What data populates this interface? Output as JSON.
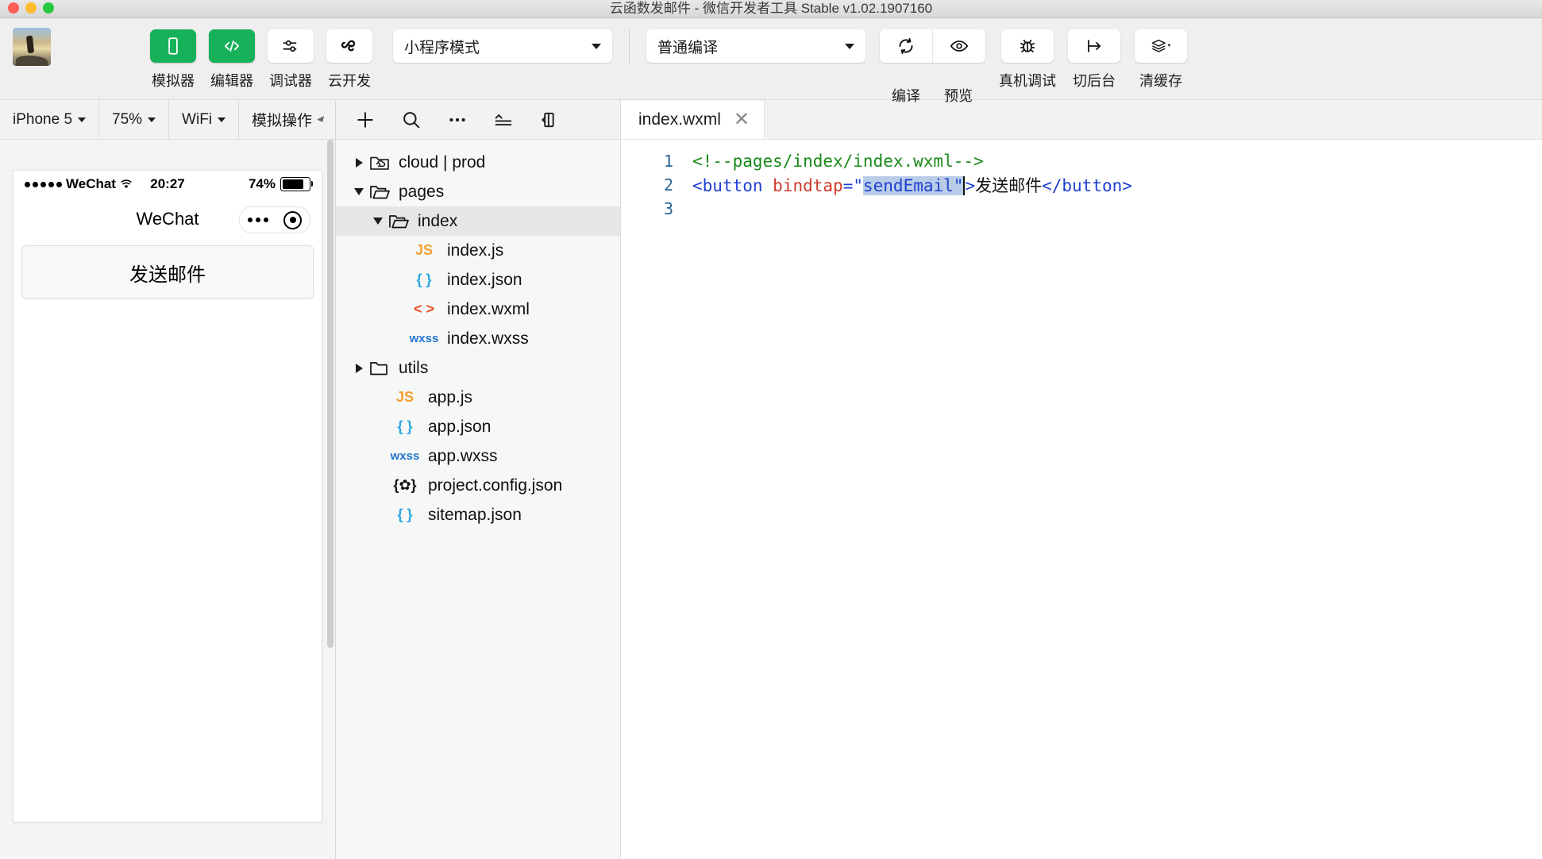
{
  "window": {
    "title": "云函数发邮件 - 微信开发者工具 Stable v1.02.1907160"
  },
  "toolbar": {
    "buttons": [
      {
        "label": "模拟器",
        "icon": "phone-icon",
        "active": true
      },
      {
        "label": "编辑器",
        "icon": "code-brackets-icon",
        "active": true
      },
      {
        "label": "调试器",
        "icon": "sliders-icon",
        "active": false
      },
      {
        "label": "云开发",
        "icon": "cloud-loop-icon",
        "active": false
      }
    ],
    "mode_select": {
      "value": "小程序模式"
    },
    "build_select": {
      "value": "普通编译"
    },
    "compile_label": "编译",
    "preview_label": "预览",
    "right_buttons": [
      {
        "label": "真机调试",
        "icon": "bug-icon"
      },
      {
        "label": "切后台",
        "icon": "switch-background-icon"
      },
      {
        "label": "清缓存",
        "icon": "layers-icon"
      }
    ]
  },
  "simulator": {
    "device": "iPhone 5",
    "zoom": "75%",
    "network": "WiFi",
    "actions": "模拟操作",
    "status_bar": {
      "carrier": "WeChat",
      "time": "20:27",
      "battery": "74%"
    },
    "nav_title": "WeChat",
    "page_button": "发送邮件"
  },
  "filetree": {
    "items": [
      {
        "name": "cloud | prod",
        "kind": "folder-cloud",
        "depth": 0,
        "arrow": "closed",
        "selected": false
      },
      {
        "name": "pages",
        "kind": "folder-open",
        "depth": 0,
        "arrow": "open",
        "selected": false
      },
      {
        "name": "index",
        "kind": "folder-open",
        "depth": 1,
        "arrow": "open",
        "selected": true
      },
      {
        "name": "index.js",
        "kind": "js",
        "depth": 2,
        "arrow": "none",
        "selected": false
      },
      {
        "name": "index.json",
        "kind": "json",
        "depth": 2,
        "arrow": "none",
        "selected": false
      },
      {
        "name": "index.wxml",
        "kind": "wxml",
        "depth": 2,
        "arrow": "none",
        "selected": false
      },
      {
        "name": "index.wxss",
        "kind": "wxss",
        "depth": 2,
        "arrow": "none",
        "selected": false
      },
      {
        "name": "utils",
        "kind": "folder",
        "depth": 0,
        "arrow": "closed",
        "selected": false
      },
      {
        "name": "app.js",
        "kind": "js",
        "depth": 1,
        "arrow": "none",
        "selected": false
      },
      {
        "name": "app.json",
        "kind": "json",
        "depth": 1,
        "arrow": "none",
        "selected": false
      },
      {
        "name": "app.wxss",
        "kind": "wxss",
        "depth": 1,
        "arrow": "none",
        "selected": false
      },
      {
        "name": "project.config.json",
        "kind": "config",
        "depth": 1,
        "arrow": "none",
        "selected": false
      },
      {
        "name": "sitemap.json",
        "kind": "json",
        "depth": 1,
        "arrow": "none",
        "selected": false
      }
    ],
    "icon_labels": {
      "js": "JS",
      "json": "{ }",
      "wxml": "< >",
      "wxss": "wxss",
      "config": "{✿}"
    }
  },
  "editor": {
    "tab_name": "index.wxml",
    "close_glyph": "✕",
    "lines": [
      {
        "num": "1"
      },
      {
        "num": "2"
      },
      {
        "num": "3"
      }
    ],
    "line1": {
      "comment": "<!--pages/index/index.wxml-->"
    },
    "line2": {
      "open_lt": "<",
      "tag": "button",
      "attr": "bindtap",
      "eq": "=",
      "quote": "\"",
      "value": "sendEmail",
      "gt": ">",
      "text": "发送邮件",
      "close": "</button>"
    }
  },
  "colors": {
    "accent_green": "#16b159",
    "comment_green": "#1a8a1a",
    "tag_blue": "#1f3fd0",
    "attr_red": "#d13b2e",
    "selection_blue": "#b9cde8"
  }
}
